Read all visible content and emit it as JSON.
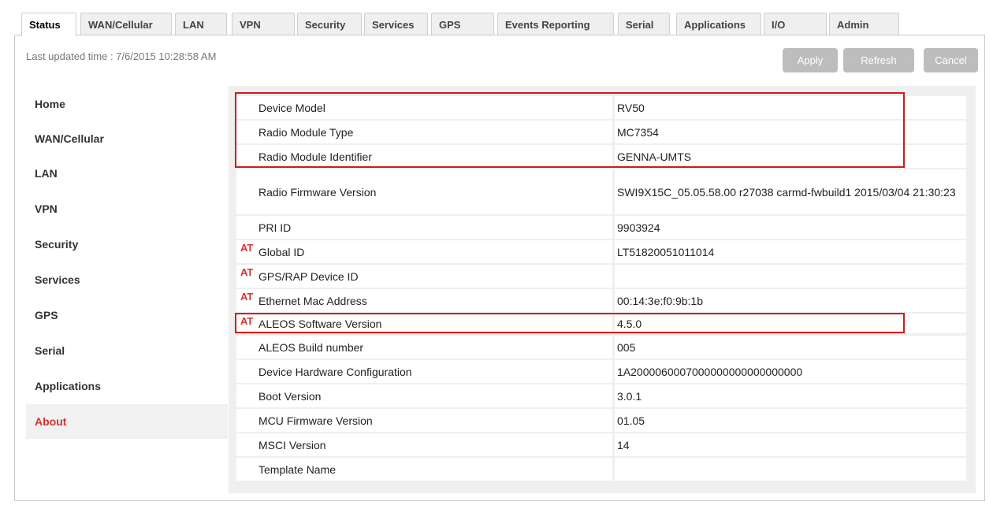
{
  "tabs": [
    "Status",
    "WAN/Cellular",
    "LAN",
    "VPN",
    "Security",
    "Services",
    "GPS",
    "Events Reporting",
    "Serial",
    "Applications",
    "I/O",
    "Admin"
  ],
  "last_updated": "Last updated time : 7/6/2015 10:28:58 AM",
  "buttons": {
    "apply": "Apply",
    "refresh": "Refresh",
    "cancel": "Cancel"
  },
  "sidebar": [
    "Home",
    "WAN/Cellular",
    "LAN",
    "VPN",
    "Security",
    "Services",
    "GPS",
    "Serial",
    "Applications",
    "About"
  ],
  "active_sidebar": "About",
  "at_marker": "AT",
  "rows": [
    {
      "label": "Device Model",
      "value": "RV50",
      "at": false
    },
    {
      "label": "Radio Module Type",
      "value": "MC7354",
      "at": false
    },
    {
      "label": "Radio Module Identifier",
      "value": "GENNA-UMTS",
      "at": false
    },
    {
      "label": "Radio Firmware Version",
      "value": "SWI9X15C_05.05.58.00 r27038 carmd-fwbuild1 2015/03/04 21:30:23",
      "at": false
    },
    {
      "label": "PRI ID",
      "value": "9903924",
      "at": false
    },
    {
      "label": "Global ID",
      "value": "LT51820051011014",
      "at": true
    },
    {
      "label": "GPS/RAP Device ID",
      "value": "",
      "at": true
    },
    {
      "label": "Ethernet Mac Address",
      "value": "00:14:3e:f0:9b:1b",
      "at": true
    },
    {
      "label": "ALEOS Software Version",
      "value": "4.5.0",
      "at": true
    },
    {
      "label": "ALEOS Build number",
      "value": "005",
      "at": false
    },
    {
      "label": "Device Hardware Configuration",
      "value": "1A2000060007000000000000000000",
      "at": false
    },
    {
      "label": "Boot Version",
      "value": "3.0.1",
      "at": false
    },
    {
      "label": "MCU Firmware Version",
      "value": "01.05",
      "at": false
    },
    {
      "label": "MSCI Version",
      "value": "14",
      "at": false
    },
    {
      "label": "Template Name",
      "value": "",
      "at": false
    }
  ],
  "colors": {
    "accent_red": "#d8302b",
    "highlight_box": "#d8161b",
    "button_gray": "#bdbdbd"
  }
}
